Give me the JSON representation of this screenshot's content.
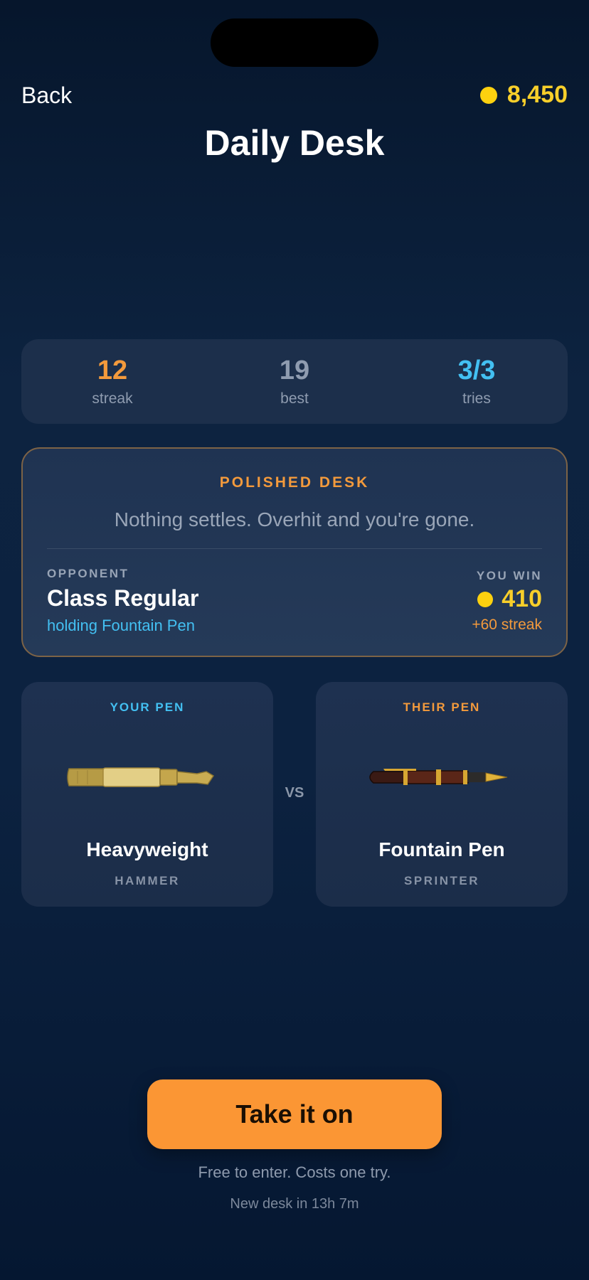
{
  "nav": {
    "back_label": "Back",
    "coin_balance": "8,450",
    "title": "Daily Desk"
  },
  "stats": [
    {
      "value": "12",
      "label": "streak",
      "color": "#f39a3c"
    },
    {
      "value": "19",
      "label": "best",
      "color": "#8f9cb0"
    },
    {
      "value": "3/3",
      "label": "tries",
      "color": "#43c0f2"
    }
  ],
  "desk": {
    "tag": "POLISHED DESK",
    "description": "Nothing settles. Overhit and you're gone.",
    "opponent_label": "OPPONENT",
    "opponent_name": "Class Regular",
    "opponent_holding": "holding Fountain Pen",
    "win_label": "YOU WIN",
    "win_amount": "410",
    "win_streak": "+60 streak"
  },
  "your_pen": {
    "tag": "YOUR PEN",
    "name": "Heavyweight",
    "class": "HAMMER",
    "icon": "highlighter-pen-icon",
    "tag_color": "#43c0f2"
  },
  "vs_label": "VS",
  "their_pen": {
    "tag": "THEIR PEN",
    "name": "Fountain Pen",
    "class": "SPRINTER",
    "icon": "fountain-pen-icon",
    "tag_color": "#f39a3c"
  },
  "cta": {
    "label": "Take it on"
  },
  "footer": {
    "entry_note": "Free to enter. Costs one try.",
    "next_desk": "New desk in 13h 7m"
  },
  "colors": {
    "accent_orange": "#fb9634",
    "coin_gold": "#fdd10f",
    "accent_blue": "#43c0f2"
  }
}
